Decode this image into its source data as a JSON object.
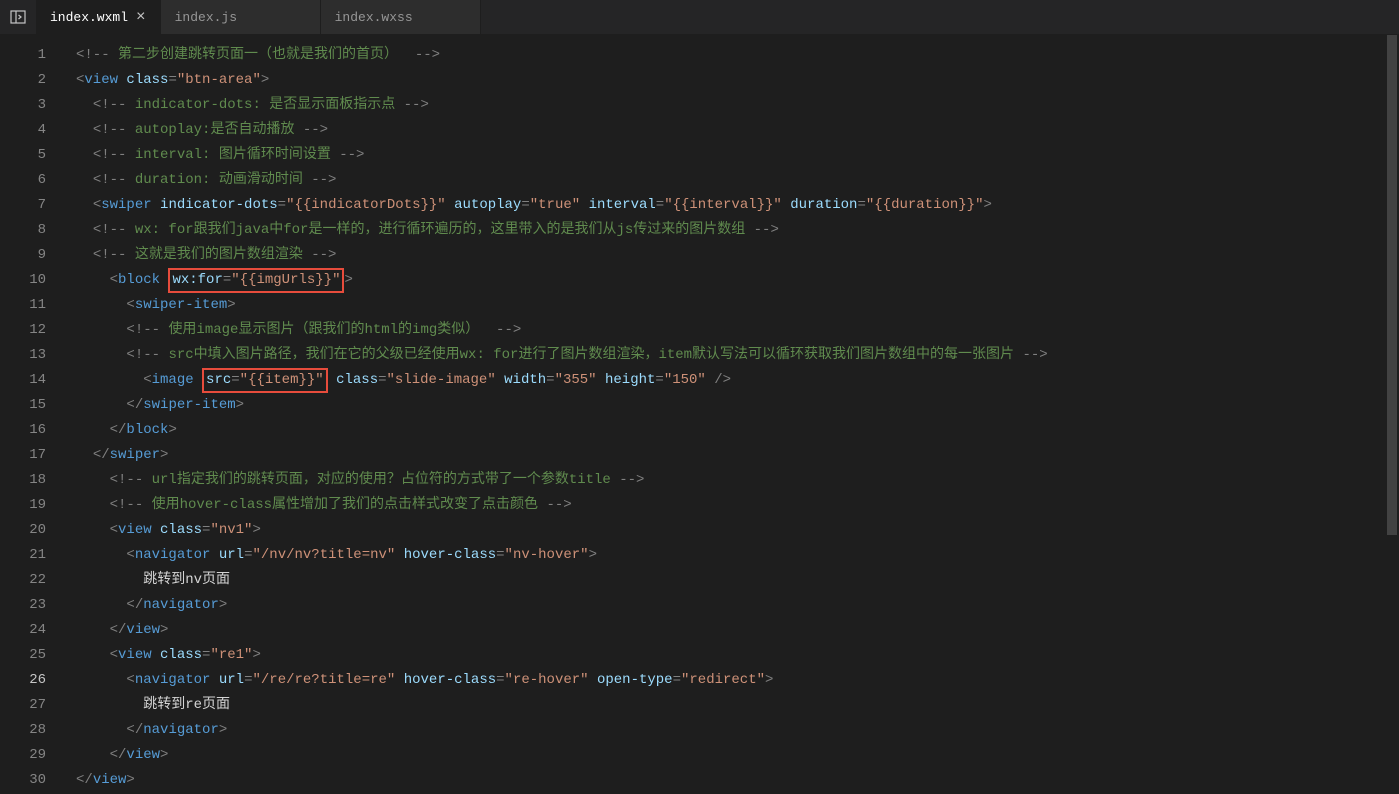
{
  "topbar": {
    "panel_icon_title": "panel layout toggle"
  },
  "tabs": {
    "items": [
      {
        "label": "index.wxml",
        "active": true,
        "close": "×"
      },
      {
        "label": "index.js",
        "active": false
      },
      {
        "label": "index.wxss",
        "active": false
      }
    ]
  },
  "gutter": {
    "start": 1,
    "end": 30,
    "active": 26
  },
  "code": {
    "highlight1_text": "wx:for=\"{{imgUrls}}\"",
    "highlight2_text": "src=\"{{item}}\"",
    "lines": [
      {
        "parts": [
          {
            "t": "c-punct",
            "v": "<!-- "
          },
          {
            "t": "c-comment",
            "v": "第二步创建跳转页面一（也就是我们的首页） "
          },
          {
            "t": "c-punct",
            "v": " -->"
          }
        ],
        "indent": 0
      },
      {
        "parts": [
          {
            "t": "c-punct",
            "v": "<"
          },
          {
            "t": "c-tag",
            "v": "view"
          },
          {
            "t": "",
            "v": " "
          },
          {
            "t": "c-attr",
            "v": "class"
          },
          {
            "t": "c-punct",
            "v": "="
          },
          {
            "t": "c-string",
            "v": "\"btn-area\""
          },
          {
            "t": "c-punct",
            "v": ">"
          }
        ],
        "indent": 0
      },
      {
        "parts": [
          {
            "t": "c-punct",
            "v": "<!-- "
          },
          {
            "t": "c-comment",
            "v": "indicator-dots: 是否显示面板指示点 "
          },
          {
            "t": "c-punct",
            "v": "-->"
          }
        ],
        "indent": 1
      },
      {
        "parts": [
          {
            "t": "c-punct",
            "v": "<!-- "
          },
          {
            "t": "c-comment",
            "v": "autoplay:是否自动播放 "
          },
          {
            "t": "c-punct",
            "v": "-->"
          }
        ],
        "indent": 1
      },
      {
        "parts": [
          {
            "t": "c-punct",
            "v": "<!-- "
          },
          {
            "t": "c-comment",
            "v": "interval: 图片循环时间设置 "
          },
          {
            "t": "c-punct",
            "v": "-->"
          }
        ],
        "indent": 1
      },
      {
        "parts": [
          {
            "t": "c-punct",
            "v": "<!-- "
          },
          {
            "t": "c-comment",
            "v": "duration: 动画滑动时间 "
          },
          {
            "t": "c-punct",
            "v": "-->"
          }
        ],
        "indent": 1
      },
      {
        "parts": [
          {
            "t": "c-punct",
            "v": "<"
          },
          {
            "t": "c-tag",
            "v": "swiper"
          },
          {
            "t": "",
            "v": " "
          },
          {
            "t": "c-attr",
            "v": "indicator-dots"
          },
          {
            "t": "c-punct",
            "v": "="
          },
          {
            "t": "c-string",
            "v": "\"{{indicatorDots}}\""
          },
          {
            "t": "",
            "v": " "
          },
          {
            "t": "c-attr",
            "v": "autoplay"
          },
          {
            "t": "c-punct",
            "v": "="
          },
          {
            "t": "c-string",
            "v": "\"true\""
          },
          {
            "t": "",
            "v": " "
          },
          {
            "t": "c-attr",
            "v": "interval"
          },
          {
            "t": "c-punct",
            "v": "="
          },
          {
            "t": "c-string",
            "v": "\"{{interval}}\""
          },
          {
            "t": "",
            "v": " "
          },
          {
            "t": "c-attr",
            "v": "duration"
          },
          {
            "t": "c-punct",
            "v": "="
          },
          {
            "t": "c-string",
            "v": "\"{{duration}}\""
          },
          {
            "t": "c-punct",
            "v": ">"
          }
        ],
        "indent": 1
      },
      {
        "parts": [
          {
            "t": "c-punct",
            "v": "<!-- "
          },
          {
            "t": "c-comment",
            "v": "wx: for跟我们java中for是一样的，进行循环遍历的，这里带入的是我们从js传过来的图片数组 "
          },
          {
            "t": "c-punct",
            "v": "-->"
          }
        ],
        "indent": 1
      },
      {
        "parts": [
          {
            "t": "c-punct",
            "v": "<!-- "
          },
          {
            "t": "c-comment",
            "v": "这就是我们的图片数组渲染 "
          },
          {
            "t": "c-punct",
            "v": "-->"
          }
        ],
        "indent": 1
      },
      {
        "indent": 2,
        "custom": "block-open"
      },
      {
        "parts": [
          {
            "t": "c-punct",
            "v": "<"
          },
          {
            "t": "c-tag",
            "v": "swiper-item"
          },
          {
            "t": "c-punct",
            "v": ">"
          }
        ],
        "indent": 3
      },
      {
        "parts": [
          {
            "t": "c-punct",
            "v": "<!-- "
          },
          {
            "t": "c-comment",
            "v": "使用image显示图片（跟我们的html的img类似） "
          },
          {
            "t": "c-punct",
            "v": " -->"
          }
        ],
        "indent": 3
      },
      {
        "parts": [
          {
            "t": "c-punct",
            "v": "<!-- "
          },
          {
            "t": "c-comment",
            "v": "src中填入图片路径，我们在它的父级已经使用wx: for进行了图片数组渲染，item默认写法可以循环获取我们图片数组中的每一张图片 "
          },
          {
            "t": "c-punct",
            "v": "-->"
          }
        ],
        "indent": 3
      },
      {
        "indent": 4,
        "custom": "image-line"
      },
      {
        "parts": [
          {
            "t": "c-punct",
            "v": "</"
          },
          {
            "t": "c-tag",
            "v": "swiper-item"
          },
          {
            "t": "c-punct",
            "v": ">"
          }
        ],
        "indent": 3
      },
      {
        "parts": [
          {
            "t": "c-punct",
            "v": "</"
          },
          {
            "t": "c-tag",
            "v": "block"
          },
          {
            "t": "c-punct",
            "v": ">"
          }
        ],
        "indent": 2
      },
      {
        "parts": [
          {
            "t": "c-punct",
            "v": "</"
          },
          {
            "t": "c-tag",
            "v": "swiper"
          },
          {
            "t": "c-punct",
            "v": ">"
          }
        ],
        "indent": 1
      },
      {
        "parts": [
          {
            "t": "c-punct",
            "v": "<!-- "
          },
          {
            "t": "c-comment",
            "v": "url指定我们的跳转页面，对应的使用？占位符的方式带了一个参数title "
          },
          {
            "t": "c-punct",
            "v": "-->"
          }
        ],
        "indent": 2
      },
      {
        "parts": [
          {
            "t": "c-punct",
            "v": "<!-- "
          },
          {
            "t": "c-comment",
            "v": "使用hover-class属性增加了我们的点击样式改变了点击颜色 "
          },
          {
            "t": "c-punct",
            "v": "-->"
          }
        ],
        "indent": 2
      },
      {
        "parts": [
          {
            "t": "c-punct",
            "v": "<"
          },
          {
            "t": "c-tag",
            "v": "view"
          },
          {
            "t": "",
            "v": " "
          },
          {
            "t": "c-attr",
            "v": "class"
          },
          {
            "t": "c-punct",
            "v": "="
          },
          {
            "t": "c-string",
            "v": "\"nv1\""
          },
          {
            "t": "c-punct",
            "v": ">"
          }
        ],
        "indent": 2
      },
      {
        "parts": [
          {
            "t": "c-punct",
            "v": "<"
          },
          {
            "t": "c-tag",
            "v": "navigator"
          },
          {
            "t": "",
            "v": " "
          },
          {
            "t": "c-attr",
            "v": "url"
          },
          {
            "t": "c-punct",
            "v": "="
          },
          {
            "t": "c-string",
            "v": "\"/nv/nv?title=nv\""
          },
          {
            "t": "",
            "v": " "
          },
          {
            "t": "c-attr",
            "v": "hover-class"
          },
          {
            "t": "c-punct",
            "v": "="
          },
          {
            "t": "c-string",
            "v": "\"nv-hover\""
          },
          {
            "t": "c-punct",
            "v": ">"
          }
        ],
        "indent": 3
      },
      {
        "parts": [
          {
            "t": "c-text",
            "v": "跳转到nv页面"
          }
        ],
        "indent": 4
      },
      {
        "parts": [
          {
            "t": "c-punct",
            "v": "</"
          },
          {
            "t": "c-tag",
            "v": "navigator"
          },
          {
            "t": "c-punct",
            "v": ">"
          }
        ],
        "indent": 3
      },
      {
        "parts": [
          {
            "t": "c-punct",
            "v": "</"
          },
          {
            "t": "c-tag",
            "v": "view"
          },
          {
            "t": "c-punct",
            "v": ">"
          }
        ],
        "indent": 2
      },
      {
        "parts": [
          {
            "t": "c-punct",
            "v": "<"
          },
          {
            "t": "c-tag",
            "v": "view"
          },
          {
            "t": "",
            "v": " "
          },
          {
            "t": "c-attr",
            "v": "class"
          },
          {
            "t": "c-punct",
            "v": "="
          },
          {
            "t": "c-string",
            "v": "\"re1\""
          },
          {
            "t": "c-punct",
            "v": ">"
          }
        ],
        "indent": 2
      },
      {
        "parts": [
          {
            "t": "c-punct",
            "v": "<"
          },
          {
            "t": "c-tag",
            "v": "navigator"
          },
          {
            "t": "",
            "v": " "
          },
          {
            "t": "c-attr",
            "v": "url"
          },
          {
            "t": "c-punct",
            "v": "="
          },
          {
            "t": "c-string",
            "v": "\"/re/re?title=re\""
          },
          {
            "t": "",
            "v": " "
          },
          {
            "t": "c-attr",
            "v": "hover-class"
          },
          {
            "t": "c-punct",
            "v": "="
          },
          {
            "t": "c-string",
            "v": "\"re-hover\""
          },
          {
            "t": "",
            "v": " "
          },
          {
            "t": "c-attr",
            "v": "open-type"
          },
          {
            "t": "c-punct",
            "v": "="
          },
          {
            "t": "c-string",
            "v": "\"redirect\""
          },
          {
            "t": "c-punct",
            "v": ">"
          }
        ],
        "indent": 3
      },
      {
        "parts": [
          {
            "t": "c-text",
            "v": "跳转到re页面"
          }
        ],
        "indent": 4
      },
      {
        "parts": [
          {
            "t": "c-punct",
            "v": "</"
          },
          {
            "t": "c-tag",
            "v": "navigator"
          },
          {
            "t": "c-punct",
            "v": ">"
          }
        ],
        "indent": 3
      },
      {
        "parts": [
          {
            "t": "c-punct",
            "v": "</"
          },
          {
            "t": "c-tag",
            "v": "view"
          },
          {
            "t": "c-punct",
            "v": ">"
          }
        ],
        "indent": 2
      },
      {
        "parts": [
          {
            "t": "c-punct",
            "v": "</"
          },
          {
            "t": "c-tag",
            "v": "view"
          },
          {
            "t": "c-punct",
            "v": ">"
          }
        ],
        "indent": 0
      }
    ]
  }
}
